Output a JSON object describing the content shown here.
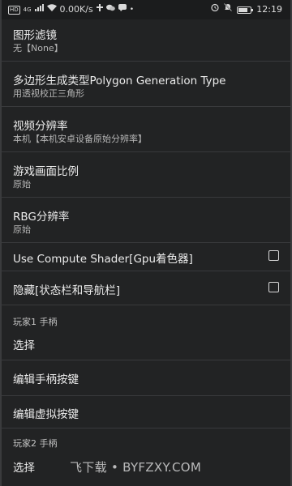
{
  "statusbar": {
    "hd": "HD",
    "network": "4G",
    "speed": "0.00K/s",
    "time": "12:19",
    "battery_level": 0.8
  },
  "settings": {
    "filter_title": "图形滤镜",
    "filter_value": "无【None】",
    "polygon_title": "多边形生成类型Polygon Generation Type",
    "polygon_value": "用透视校正三角形",
    "resolution_title": "视频分辨率",
    "resolution_value": "本机【本机安卓设备原始分辨率】",
    "aspect_title": "游戏画面比例",
    "aspect_value": "原始",
    "rbg_title": "RBG分辨率",
    "rbg_value": "原始",
    "compute_shader_title": "Use Compute Shader[Gpu着色器]",
    "compute_shader_checked": false,
    "hide_bars_title": "隐藏[状态栏和导航栏]",
    "hide_bars_checked": false,
    "player1_category": "玩家1 手柄",
    "player1_select": "选择",
    "edit_gamepad": "编辑手柄按键",
    "edit_virtual": "编辑虚拟按键",
    "player2_category": "玩家2 手柄",
    "player2_select": "选择"
  },
  "watermark": "飞下载 • BYFZXY.COM"
}
